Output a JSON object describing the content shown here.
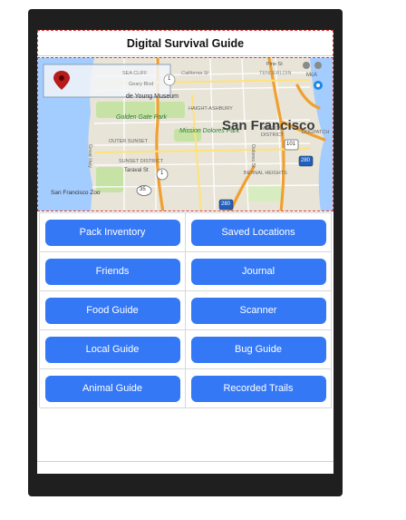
{
  "app": {
    "title": "Digital Survival Guide"
  },
  "map": {
    "labels": {
      "city": "San Francisco",
      "sea_cliff": "SEA CLIFF",
      "california_st": "California St",
      "geary_blvd": "Geary Blvd",
      "pine_st": "Pine St",
      "tenderloin": "TENDERLOIN",
      "mcallister": "McA",
      "de_young": "de Young Museum",
      "haight_ashbury": "HAIGHT-ASHBURY",
      "golden_gate_park": "Golden Gate Park",
      "mission_dolores": "Mission Dolores Park",
      "mission_district": "MISSION DISTRICT",
      "dogpatch": "DOGPATCH",
      "outer_sunset": "OUTER SUNSET",
      "sunset_district": "SUNSET DISTRICT",
      "taraval": "Taraval St",
      "bernal": "BERNAL HEIGHTS",
      "zoo": "San Francisco Zoo",
      "great_hwy": "Great Hwy",
      "dolores_st": "Dolores St",
      "hwy_1": "1",
      "hwy_35": "35",
      "hwy_101": "101",
      "hwy_280": "280",
      "hwy_280b": "280"
    },
    "colors": {
      "water": "#a3ccff",
      "land": "#e8e4d8",
      "park": "#c6e3a5",
      "highway": "#f0a030",
      "road": "#ffffff"
    }
  },
  "menu": {
    "buttons": [
      {
        "id": "pack-inventory",
        "label": "Pack Inventory"
      },
      {
        "id": "saved-locations",
        "label": "Saved Locations"
      },
      {
        "id": "friends",
        "label": "Friends"
      },
      {
        "id": "journal",
        "label": "Journal"
      },
      {
        "id": "food-guide",
        "label": "Food Guide"
      },
      {
        "id": "scanner",
        "label": "Scanner"
      },
      {
        "id": "local-guide",
        "label": "Local Guide"
      },
      {
        "id": "bug-guide",
        "label": "Bug Guide"
      },
      {
        "id": "animal-guide",
        "label": "Animal Guide"
      },
      {
        "id": "recorded-trails",
        "label": "Recorded Trails"
      }
    ]
  },
  "theme": {
    "button_color": "#3478f6",
    "device_frame": "#1f1f1f"
  }
}
